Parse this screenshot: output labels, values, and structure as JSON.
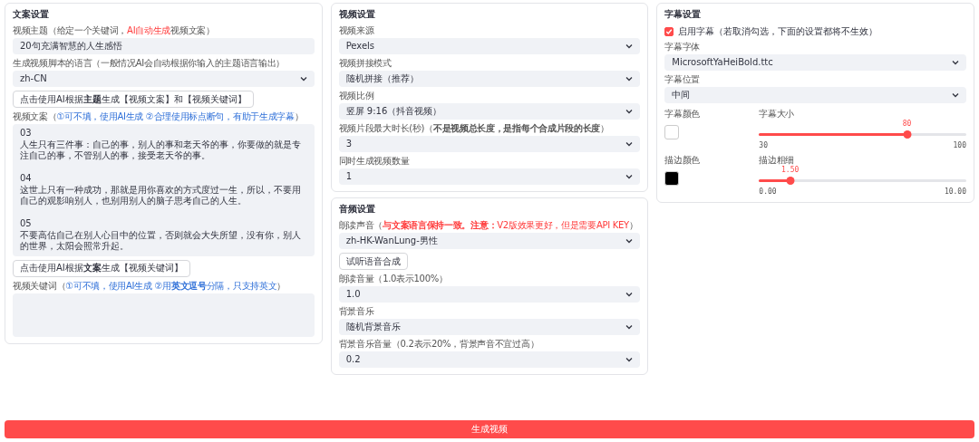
{
  "columns": [
    [
      {
        "title": "文案设置",
        "fields": [
          {
            "kind": "text",
            "label": [
              {
                "text": "视频主题（给定一个关键词，"
              },
              {
                "text": "AI自动生成",
                "color": "#ff3b3b"
              },
              {
                "text": "视频文案）"
              }
            ],
            "value": "20句充满智慧的人生感悟"
          },
          {
            "kind": "select",
            "label": [
              {
                "text": "生成视频脚本的语言（一般情况AI会自动根据你输入的主题语言输出）"
              }
            ],
            "value": "zh-CN"
          },
          {
            "kind": "button",
            "text": "点击使用AI根据**主题**生成【视频文案】和【视频关键词】"
          },
          {
            "kind": "textarea",
            "label": [
              {
                "text": "视频文案（"
              },
              {
                "text": "①可不填，使用AI生成 ②合理使用标点断句，有助于生成字幕",
                "color": "#2e6fd8"
              },
              {
                "text": "）"
              }
            ],
            "value": "03\n人生只有三件事：自己的事，别人的事和老天爷的事，你要做的就是专注自己的事，不管别人的事，接受老天爷的事。\n\n04\n这世上只有一种成功，那就是用你喜欢的方式度过一生，所以，不要用自己的观影响别人，也别用别人的脑子思考自己的人生。\n\n05\n不要高估自己在别人心目中的位置，否则就会大失所望，没有你，别人的世界，太阳会照常升起。"
          },
          {
            "kind": "button",
            "text": "点击使用AI根据**文案**生成【视频关键词】"
          },
          {
            "kind": "textarea",
            "label": [
              {
                "text": "视频关键词（"
              },
              {
                "text": "①可不填，使用AI生成 ②用**英文逗号**分隔，只支持英文",
                "color": "#2e6fd8"
              },
              {
                "text": "）"
              }
            ]
          }
        ]
      }
    ],
    [
      {
        "title": "视频设置",
        "fields": [
          {
            "kind": "select",
            "label": [
              {
                "text": "视频来源"
              }
            ],
            "value": "Pexels"
          },
          {
            "kind": "select",
            "label": [
              {
                "text": "视频拼接模式"
              }
            ],
            "value": "随机拼接（推荐）"
          },
          {
            "kind": "select",
            "label": [
              {
                "text": "视频比例"
              }
            ],
            "value": "竖屏 9:16（抖音视频）"
          },
          {
            "kind": "select",
            "label": [
              {
                "text": "视频片段最大时长(秒)（**不是视频总长度，是指每个合成片段的长度**）"
              }
            ],
            "value": "3"
          },
          {
            "kind": "select",
            "label": [
              {
                "text": "同时生成视频数量"
              }
            ],
            "value": "1"
          }
        ]
      },
      {
        "title": "音频设置",
        "fields": [
          {
            "kind": "select",
            "label": [
              {
                "text": "朗读声音（"
              },
              {
                "text": "**与文案语言保持一致。注意：**V2版效果更好，但是需要API KEY",
                "color": "#ff3b3b"
              },
              {
                "text": "）"
              }
            ],
            "value": "zh-HK-WanLung-男性"
          },
          {
            "kind": "button",
            "text": "试听语音合成"
          },
          {
            "kind": "select",
            "label": [
              {
                "text": "朗读音量（1.0表示100%）"
              }
            ],
            "value": "1.0"
          },
          {
            "kind": "select",
            "label": [
              {
                "text": "背景音乐"
              }
            ],
            "value": "随机背景音乐"
          },
          {
            "kind": "select",
            "label": [
              {
                "text": "背景音乐音量（0.2表示20%，背景声音不宜过高）"
              }
            ],
            "value": "0.2"
          }
        ]
      }
    ],
    [
      {
        "title": "字幕设置",
        "fields": [
          {
            "kind": "checkbox",
            "text": "启用字幕（若取消勾选，下面的设置都将不生效）",
            "checked": true
          },
          {
            "kind": "select",
            "label": [
              {
                "text": "字幕字体"
              }
            ],
            "value": "MicrosoftYaHeiBold.ttc"
          },
          {
            "kind": "select",
            "label": [
              {
                "text": "字幕位置"
              }
            ],
            "value": "中间"
          },
          {
            "kind": "color-slider",
            "color_label": "字幕颜色",
            "color": "#ffffff",
            "slider_label": "字幕大小",
            "value_text": "80",
            "min": "30",
            "max": "100",
            "level": 0.714
          },
          {
            "kind": "color-slider",
            "color_label": "描边颜色",
            "color": "#000000",
            "slider_label": "描边粗细",
            "value_text": "1.50",
            "min": "0.00",
            "max": "10.00",
            "level": 0.15
          }
        ]
      }
    ]
  ],
  "generate_button": "生成视频"
}
